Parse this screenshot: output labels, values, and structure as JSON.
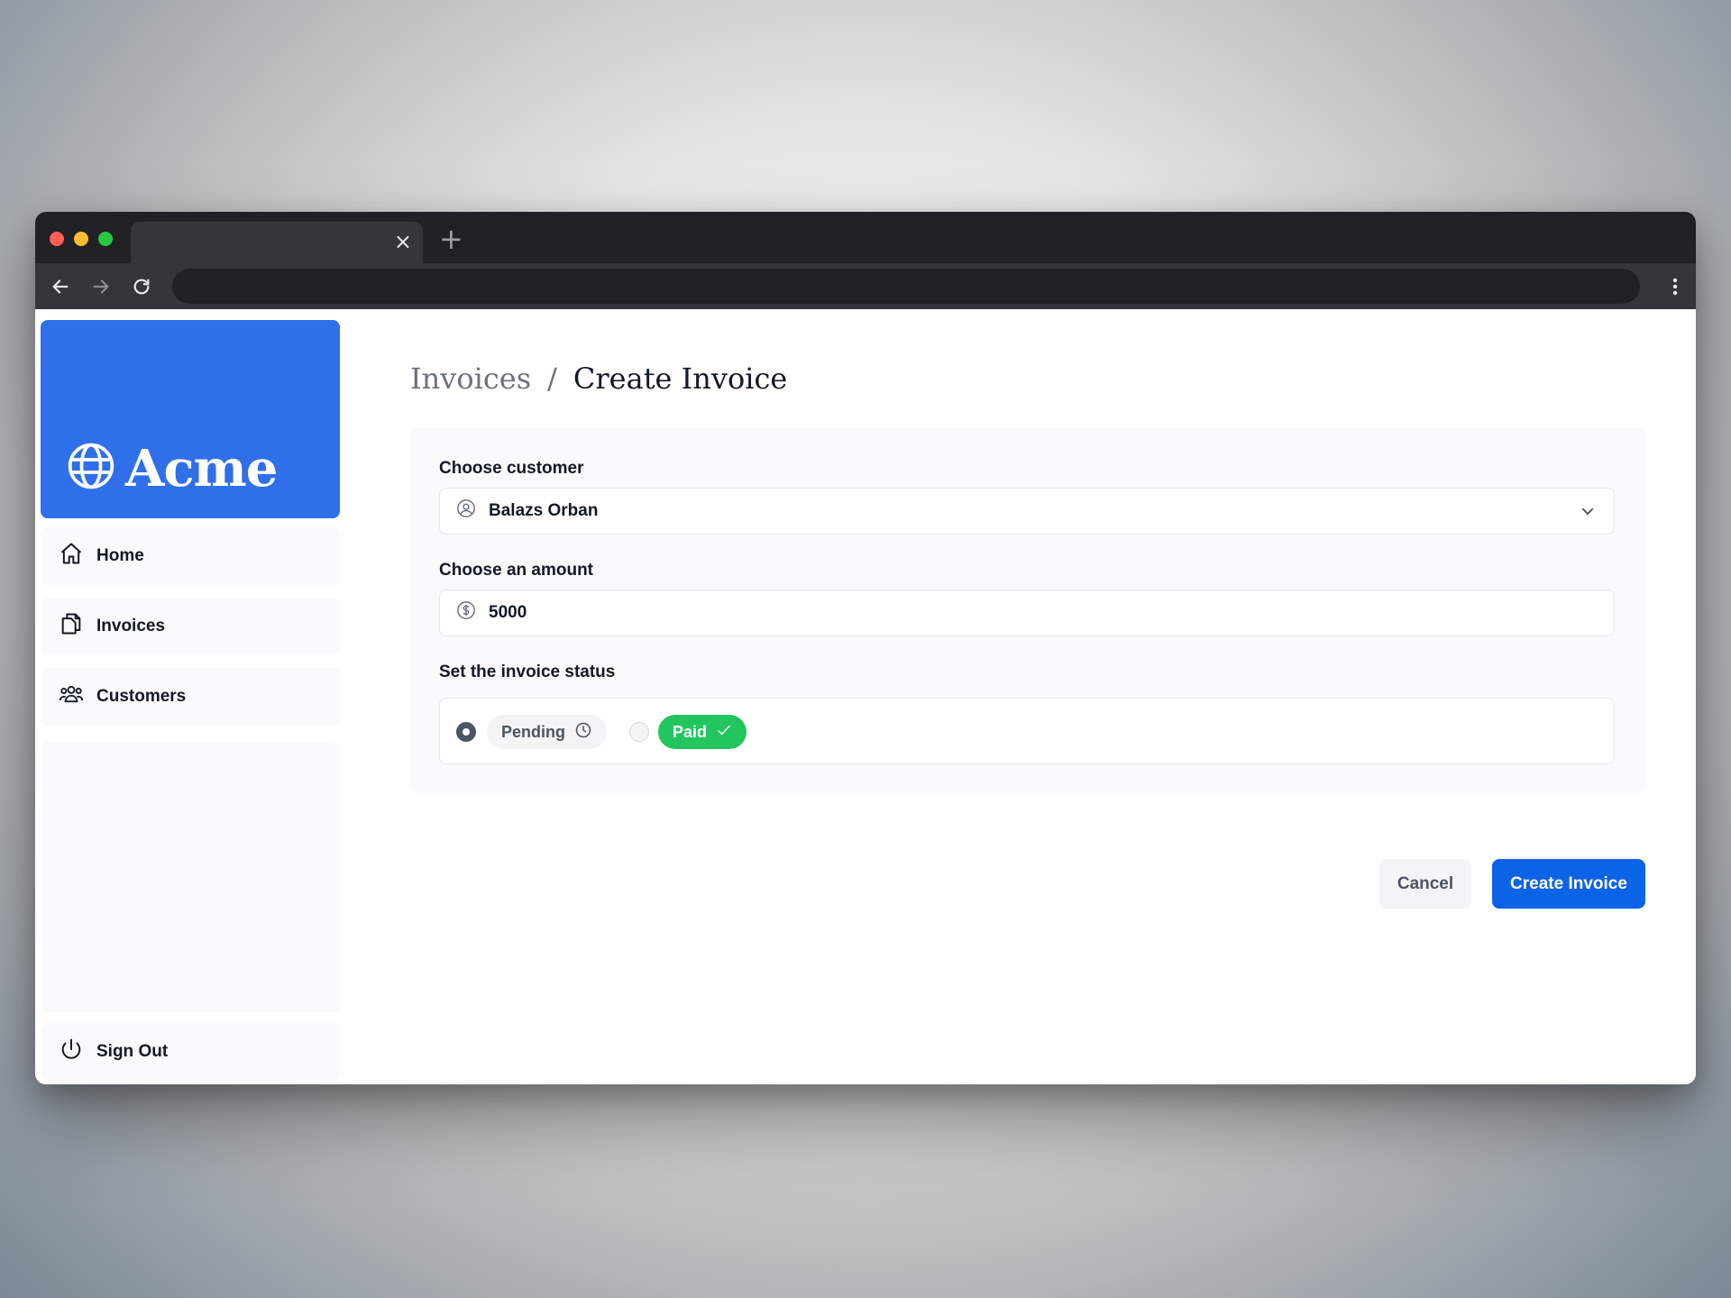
{
  "browser": {
    "tab_close_glyph": "×",
    "new_tab_glyph": "+",
    "traffic_lights": [
      "#ff5f57",
      "#febc2e",
      "#28c840"
    ]
  },
  "sidebar": {
    "brand": "Acme",
    "brand_color": "#2f6fea",
    "items": [
      {
        "label": "Home",
        "icon": "home-icon"
      },
      {
        "label": "Invoices",
        "icon": "document-duplicate-icon"
      },
      {
        "label": "Customers",
        "icon": "user-group-icon"
      }
    ],
    "sign_out": {
      "label": "Sign Out",
      "icon": "power-icon"
    }
  },
  "breadcrumb": {
    "parent": "Invoices",
    "separator": "/",
    "current": "Create Invoice"
  },
  "form": {
    "customer": {
      "label": "Choose customer",
      "value": "Balazs Orban",
      "icon": "user-circle-icon"
    },
    "amount": {
      "label": "Choose an amount",
      "value": "5000",
      "icon": "currency-dollar-icon"
    },
    "status": {
      "label": "Set the invoice status",
      "options": [
        {
          "label": "Pending",
          "selected": true,
          "icon": "clock-icon"
        },
        {
          "label": "Paid",
          "selected": false,
          "icon": "check-icon"
        }
      ]
    }
  },
  "actions": {
    "cancel_label": "Cancel",
    "submit_label": "Create Invoice",
    "primary_color": "#0c63e7"
  }
}
